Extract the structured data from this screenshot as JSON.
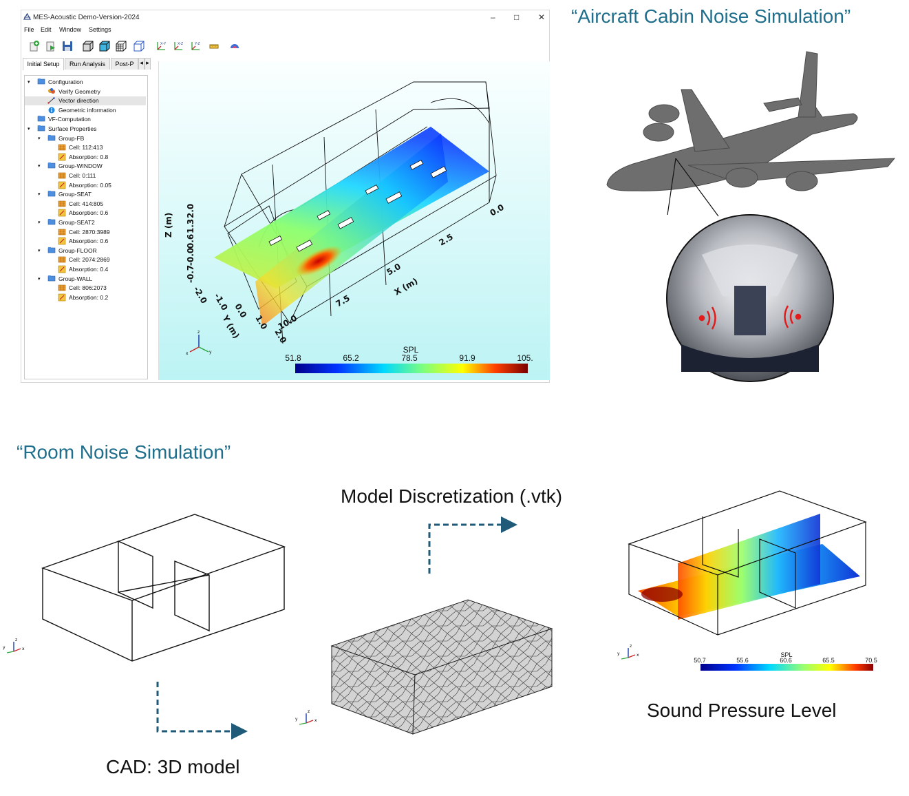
{
  "window": {
    "title": "MES-Acoustic Demo-Version-2024",
    "minimize_glyph": "–",
    "maximize_glyph": "□",
    "close_glyph": "✕",
    "menu": [
      "File",
      "Edit",
      "Window",
      "Settings"
    ],
    "toolbar_icons": [
      "new-icon",
      "run-icon",
      "save-icon",
      "solid-view-icon",
      "shaded-view-icon",
      "mesh-view-icon",
      "wireframe-view-icon",
      "view-xy-icon",
      "view-xz-icon",
      "view-yz-icon",
      "ruler-icon",
      "colormap-icon"
    ],
    "toolbar_labels": [
      "X-Y",
      "X-Z",
      "Y-Z"
    ],
    "tabs": [
      "Initial Setup",
      "Run Analysis",
      "Post-P"
    ],
    "tab_arrows": [
      "◂",
      "▸"
    ],
    "tree": [
      {
        "label": "Configuration",
        "level": 0,
        "icon": "folder-icon"
      },
      {
        "label": "Verify Geometry",
        "level": 1,
        "icon": "check-geometry-icon"
      },
      {
        "label": "Vector direction",
        "level": 1,
        "icon": "vector-icon",
        "selected": true
      },
      {
        "label": "Geometric information",
        "level": 1,
        "icon": "info-icon"
      },
      {
        "label": "VF-Computation",
        "level": 0,
        "icon": "folder-icon"
      },
      {
        "label": "Surface Properties",
        "level": 0,
        "icon": "folder-icon"
      },
      {
        "label": "Group-FB",
        "level": 1,
        "icon": "folder-icon"
      },
      {
        "label": "Cell: 112:413",
        "level": 2,
        "icon": "cell-icon"
      },
      {
        "label": "Absorption: 0.8",
        "level": 2,
        "icon": "absorption-icon"
      },
      {
        "label": "Group-WINDOW",
        "level": 1,
        "icon": "folder-icon"
      },
      {
        "label": "Cell: 0:111",
        "level": 2,
        "icon": "cell-icon"
      },
      {
        "label": "Absorption: 0.05",
        "level": 2,
        "icon": "absorption-icon"
      },
      {
        "label": "Group-SEAT",
        "level": 1,
        "icon": "folder-icon"
      },
      {
        "label": "Cell: 414:805",
        "level": 2,
        "icon": "cell-icon"
      },
      {
        "label": "Absorption: 0.6",
        "level": 2,
        "icon": "absorption-icon"
      },
      {
        "label": "Group-SEAT2",
        "level": 1,
        "icon": "folder-icon"
      },
      {
        "label": "Cell: 2870:3989",
        "level": 2,
        "icon": "cell-icon"
      },
      {
        "label": "Absorption: 0.6",
        "level": 2,
        "icon": "absorption-icon"
      },
      {
        "label": "Group-FLOOR",
        "level": 1,
        "icon": "folder-icon"
      },
      {
        "label": "Cell: 2074:2869",
        "level": 2,
        "icon": "cell-icon"
      },
      {
        "label": "Absorption: 0.4",
        "level": 2,
        "icon": "absorption-icon"
      },
      {
        "label": "Group-WALL",
        "level": 1,
        "icon": "folder-icon"
      },
      {
        "label": "Cell: 806:2073",
        "level": 2,
        "icon": "cell-icon"
      },
      {
        "label": "Absorption: 0.2",
        "level": 2,
        "icon": "absorption-icon"
      }
    ]
  },
  "viewport": {
    "z_axis_title": "Z (m)",
    "z_ticks": [
      "2.0",
      "1.3",
      "0.6",
      "-0.0",
      "-0.7"
    ],
    "y_axis_title": "Y (m)",
    "y_ticks": [
      "-2.0",
      "-1.0",
      "0.0",
      "1.0",
      "2.0"
    ],
    "x_axis_title": "X (m)",
    "x_ticks": [
      "10.0",
      "7.5",
      "5.0",
      "2.5",
      "0.0"
    ],
    "colorbar": {
      "title": "SPL",
      "ticks": [
        "51.8",
        "65.2",
        "78.5",
        "91.9",
        "105."
      ]
    },
    "triad_labels": [
      "z",
      "x",
      "y"
    ]
  },
  "captions": {
    "aircraft": "“Aircraft Cabin Noise Simulation”",
    "room": "“Room Noise Simulation”"
  },
  "room": {
    "cad_label": "CAD: 3D model",
    "mesh_label": "Model Discretization (.vtk)",
    "spl_label": "Sound Pressure Level",
    "colorbar": {
      "title": "SPL",
      "ticks": [
        "50.7",
        "55.6",
        "60.6",
        "65.5",
        "70.5"
      ]
    },
    "triad_labels": [
      "z",
      "y",
      "x"
    ]
  },
  "colors": {
    "caption": "#1f6e8c",
    "arrow": "#1f5a78",
    "aircraft_body": "#6e6e6e"
  }
}
